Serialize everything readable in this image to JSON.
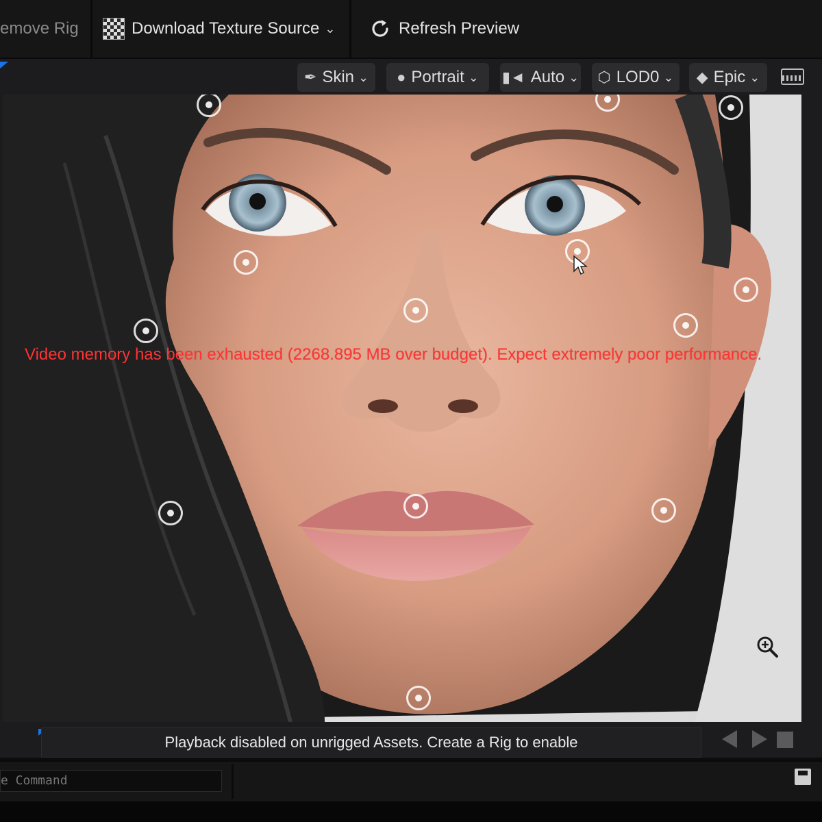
{
  "toolbar": {
    "remove_rig_label": "emove Rig",
    "download_label": "Download Texture Source",
    "refresh_label": "Refresh Preview"
  },
  "viewport_toolbar": {
    "skin_label": "Skin",
    "portrait_label": "Portrait",
    "auto_label": "Auto",
    "lod_label": "LOD0",
    "quality_label": "Epic"
  },
  "viewport": {
    "warning": "Video memory has been exhausted (2268.895 MB over budget). Expect extremely poor performance.",
    "warning_color": "#ff3434"
  },
  "playback": {
    "message": "Playback disabled on unrigged Assets. Create a Rig to enable"
  },
  "command": {
    "placeholder": "e Command"
  },
  "icons": {
    "download": "checkerboard-icon",
    "refresh": "refresh-icon",
    "skin": "brush-icon",
    "portrait": "lightbulb-icon",
    "auto": "camera-icon",
    "lod": "cube-icon",
    "quality": "diamond-icon",
    "keyboard": "keyboard-icon",
    "zoom": "zoom-icon",
    "save": "save-icon"
  }
}
